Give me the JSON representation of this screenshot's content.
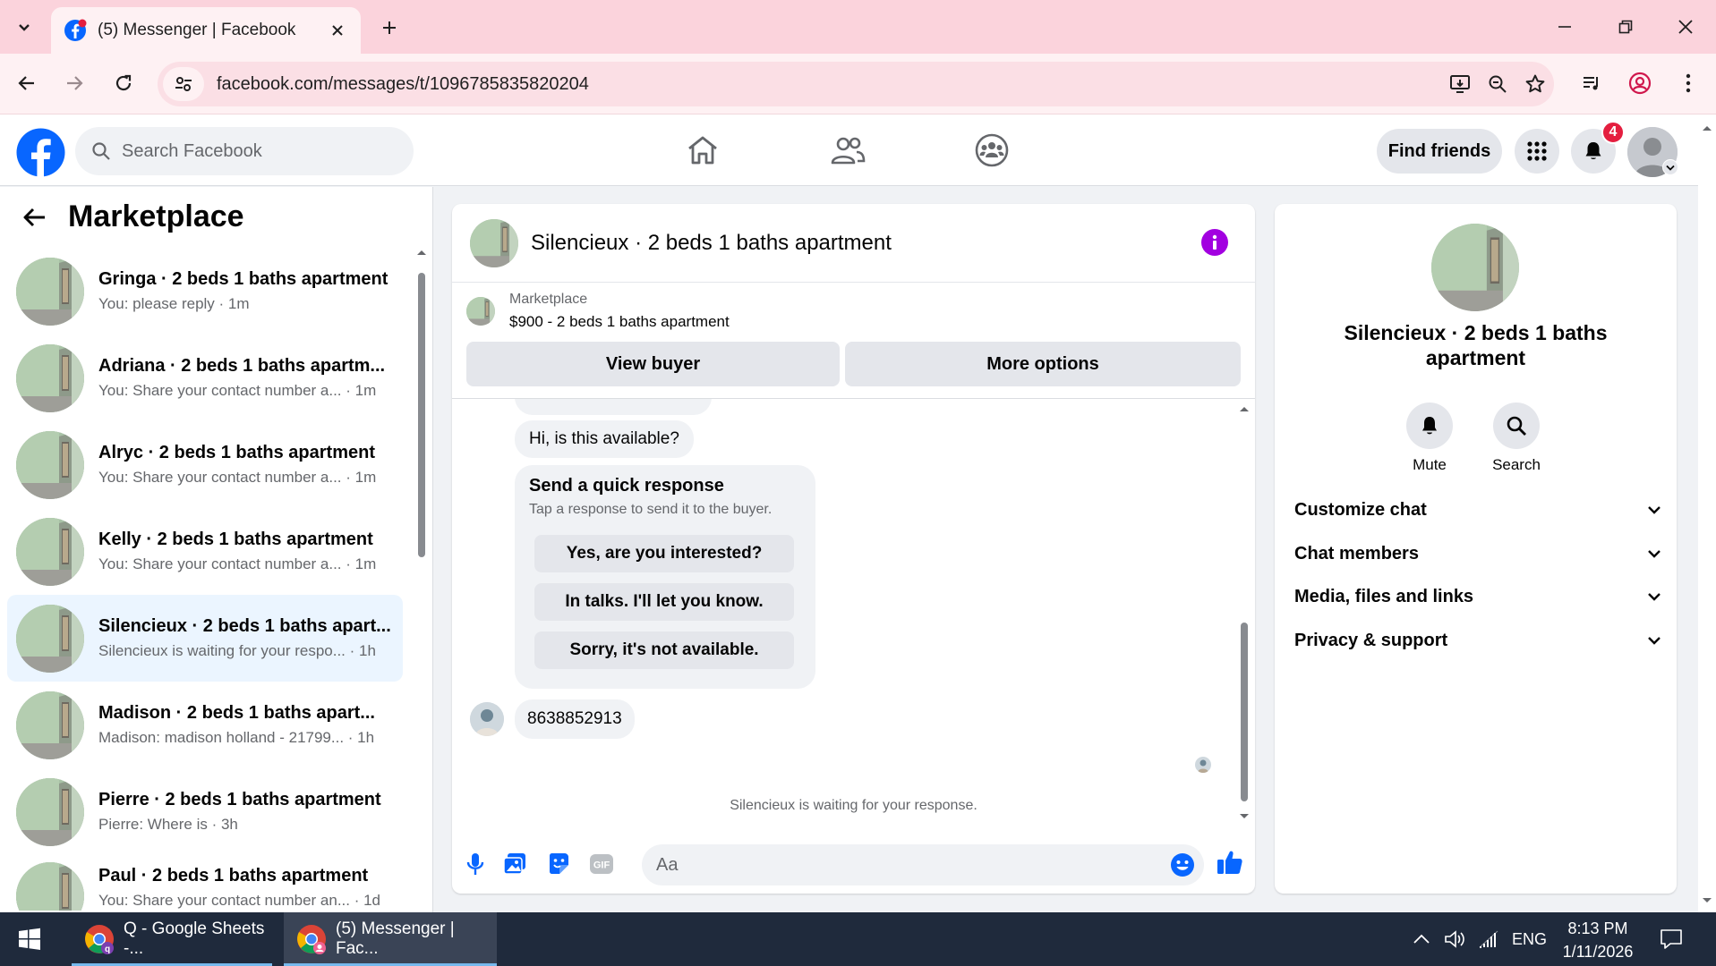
{
  "browser": {
    "tab_title": "(5) Messenger | Facebook",
    "url": "facebook.com/messages/t/1096785835820204"
  },
  "fb": {
    "search_placeholder": "Search Facebook",
    "find_friends": "Find friends",
    "notification_count": "4"
  },
  "sidebar": {
    "title": "Marketplace",
    "conversations": [
      {
        "name": "Gringa · 2 beds 1 baths apartment",
        "preview": "You: please reply · 1m"
      },
      {
        "name": "Adriana · 2 beds 1 baths apartm...",
        "preview": "You: Share your contact number a... · 1m"
      },
      {
        "name": "Alryc · 2 beds 1 baths apartment",
        "preview": "You: Share your contact number a... · 1m"
      },
      {
        "name": "Kelly · 2 beds 1 baths apartment",
        "preview": "You: Share your contact number a... · 1m"
      },
      {
        "name": "Silencieux · 2 beds 1 baths apart...",
        "preview": "Silencieux is waiting for your respo... · 1h"
      },
      {
        "name": "Madison · 2 beds 1 baths apart...",
        "preview": "Madison: madison holland - 21799... · 1h"
      },
      {
        "name": "Pierre · 2 beds 1 baths apartment",
        "preview": "Pierre: Where is · 3h"
      },
      {
        "name": "Paul · 2 beds 1 baths apartment",
        "preview": "You: Share your contact number an... · 1d"
      }
    ]
  },
  "chat": {
    "title": "Silencieux · 2 beds 1 baths apartment",
    "marketplace_label": "Marketplace",
    "listing": "$900 - 2 beds 1 baths apartment",
    "view_buyer": "View buyer",
    "more_options": "More options",
    "msg_available": "Hi, is this available?",
    "quick_title": "Send a quick response",
    "quick_sub": "Tap a response to send it to the buyer.",
    "quick_replies": [
      "Yes, are you interested?",
      "In talks. I'll let you know.",
      "Sorry, it's not available."
    ],
    "msg_number": "8638852913",
    "waiting": "Silencieux is waiting for your response.",
    "composer_placeholder": "Aa"
  },
  "details": {
    "name": "Silencieux · 2 beds 1 baths apartment",
    "mute": "Mute",
    "search": "Search",
    "rows": [
      "Customize chat",
      "Chat members",
      "Media, files and links",
      "Privacy & support"
    ]
  },
  "taskbar": {
    "app1": "Q - Google Sheets -...",
    "app2": "(5) Messenger | Fac...",
    "lang": "ENG",
    "time": "8:13 PM",
    "date": "1/11/2026"
  },
  "colors": {
    "fb_blue": "#0866ff",
    "accent_purple": "#a200e0",
    "chrome_pink": "#fbd3dc",
    "badge_red": "#e41e3f"
  }
}
